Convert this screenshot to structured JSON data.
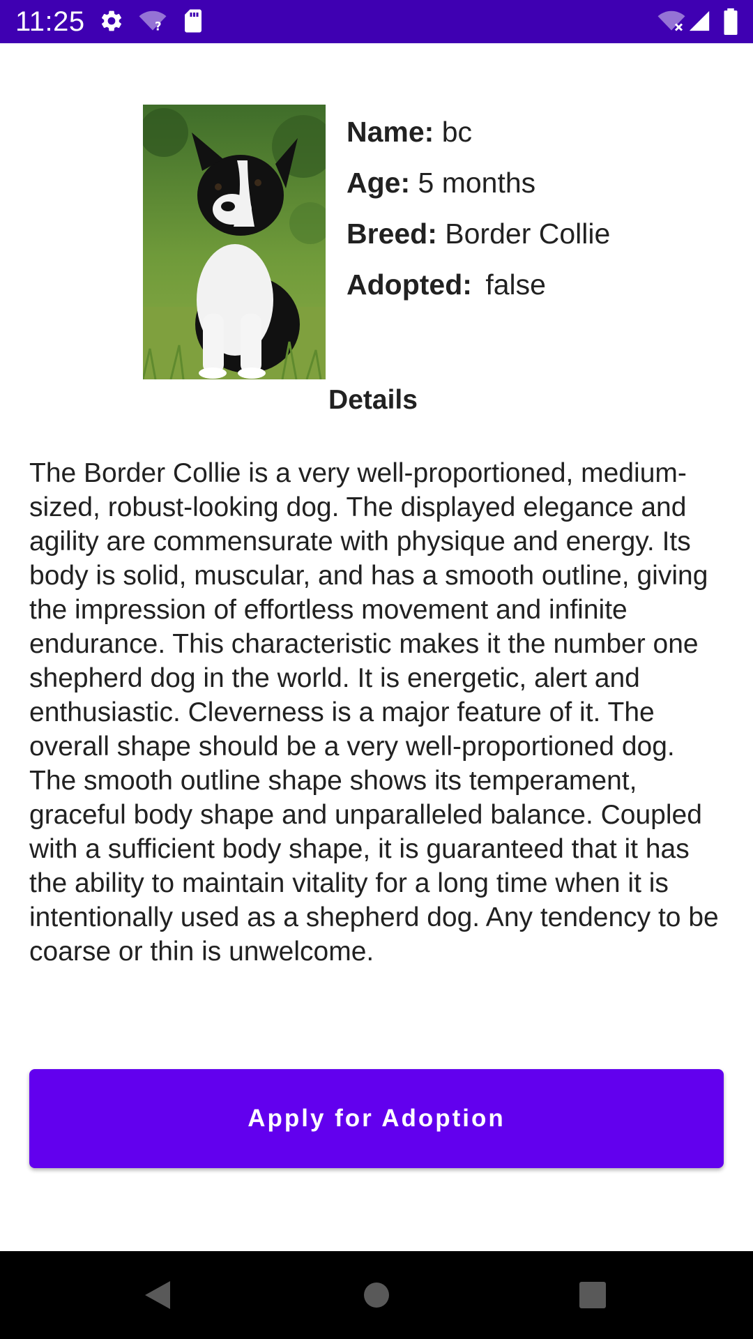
{
  "status_bar": {
    "time": "11:25",
    "icons": [
      "gear-icon",
      "wifi-question-icon",
      "sd-card-icon",
      "wifi-x-icon",
      "signal-icon",
      "battery-icon"
    ],
    "background": "#3f00b2"
  },
  "pet": {
    "photo": "border-collie-puppy-photo",
    "name_label": "Name:",
    "name_value": "bc",
    "age_label": "Age:",
    "age_value": "5 months",
    "breed_label": "Breed:",
    "breed_value": "Border Collie",
    "adopted_label": "Adopted:",
    "adopted_value": "false"
  },
  "details": {
    "heading": "Details",
    "body": "The Border Collie is a very well-proportioned, medium-sized, robust-looking dog. The displayed elegance and agility are commensurate with physique and energy. Its body is solid, muscular, and has a smooth outline, giving the impression of effortless movement and infinite endurance. This characteristic makes it the number one shepherd dog in the world. It is energetic, alert and enthusiastic. Cleverness is a major feature of it. The overall shape should be a very well-proportioned dog. The smooth outline shape shows its temperament, graceful body shape and unparalleled balance. Coupled with a sufficient body shape, it is guaranteed that it has the ability to maintain vitality for a long time when it is intentionally used as a shepherd dog. Any tendency to be coarse or thin is unwelcome."
  },
  "actions": {
    "apply_label": "Apply for Adoption",
    "button_color": "#6200ee"
  },
  "nav_bar": {
    "icons": [
      "back-icon",
      "home-icon",
      "recents-icon"
    ]
  }
}
